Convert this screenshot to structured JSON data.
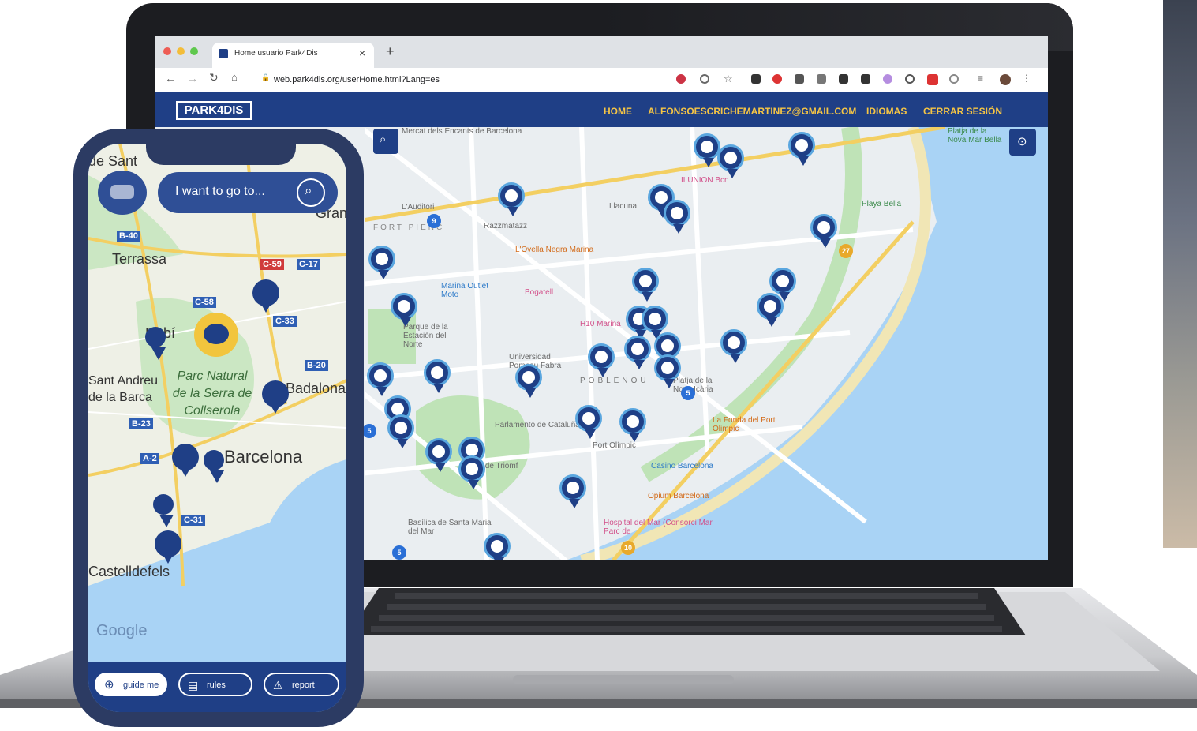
{
  "browser": {
    "tab_title": "Home usuario Park4Dis",
    "url": "web.park4dis.org/userHome.html?Lang=es",
    "new_tab": "+",
    "close_tab": "×"
  },
  "site": {
    "logo": "PARK4DIS",
    "nav": [
      "HOME",
      "ALFONSOESCRICHEMARTINEZ@GMAIL.COM",
      "IDIOMAS",
      "CERRAR SESIÓN"
    ]
  },
  "desktop_map": {
    "labels": [
      "Mercat dels Encants de Barcelona",
      "L'Auditori",
      "FORT PIENC",
      "Razzmatazz",
      "Llacuna",
      "ILUNION Bcn",
      "Platja de la Nova Mar Bella",
      "Playa Bella",
      "Parque de la Estación del Norte",
      "Marina Outlet Moto",
      "Bogatell",
      "L'Ovella Negra Marina",
      "H10 Marina",
      "Universidad Pompeu Fabra",
      "POBLENOU",
      "Platja de la Nova Icària",
      "Parlamento de Cataluña",
      "Casino Barcelona",
      "Opium Barcelona",
      "Hospital del Mar (Consorci Mar Parc de",
      "La Fonda del Port Olimpic",
      "Basílica de Santa Maria del Mar",
      "Arc de Triomf",
      "Port Olímpic"
    ],
    "clusters": [
      "9",
      "27",
      "5",
      "5",
      "10",
      "5"
    ]
  },
  "phone": {
    "search_placeholder": "I want to go to...",
    "map_labels": [
      "de Sant",
      "Terrassa",
      "Rubí",
      "Sant Andreu de la Barca",
      "Parc Natural de la Serra de Collserola",
      "Badalona",
      "Barcelona",
      "Castelldefels",
      "Gran"
    ],
    "roads": [
      "B-40",
      "C-59",
      "C-17",
      "C-58",
      "C-33",
      "B-20",
      "B-23",
      "A-2",
      "C-31"
    ],
    "google": "Google",
    "buttons": [
      "guide me",
      "rules",
      "report"
    ]
  }
}
